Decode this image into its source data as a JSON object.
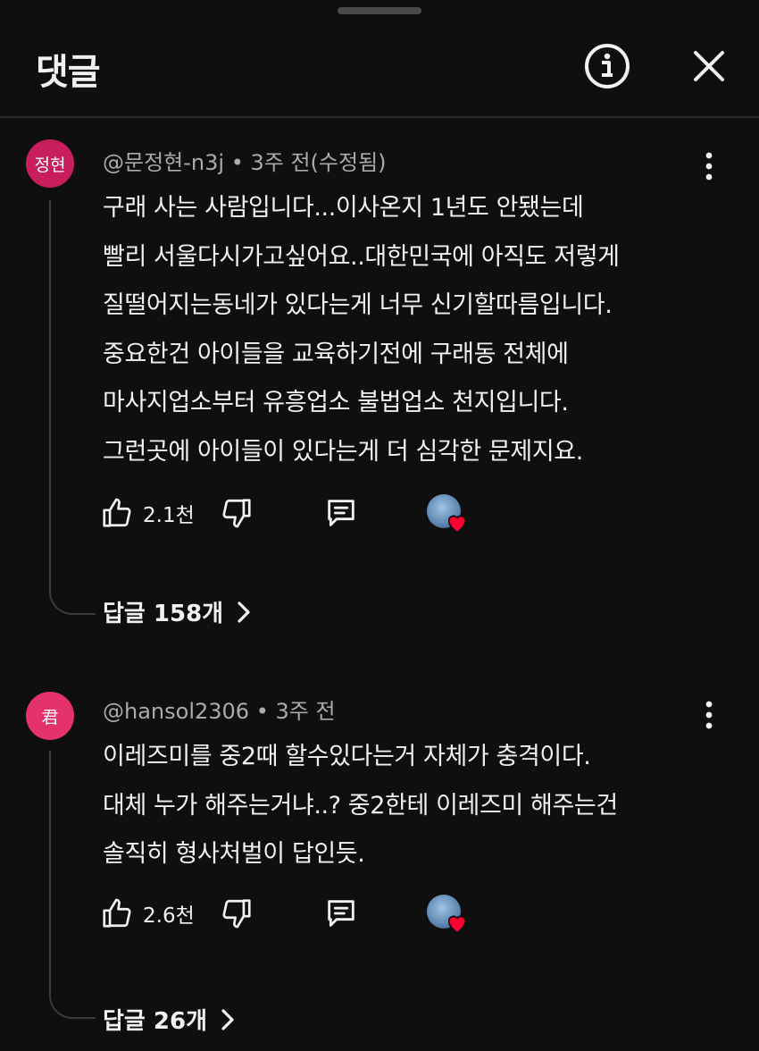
{
  "header": {
    "title": "댓글"
  },
  "icons": {
    "info": "info-icon",
    "close": "close-icon",
    "more": "more-vert-icon",
    "like": "thumbs-up-icon",
    "dislike": "thumbs-down-icon",
    "reply": "comment-reply-icon",
    "hearted": "creator-heart-icon",
    "chevron": "chevron-right-icon"
  },
  "colors": {
    "background": "#0f0f0f",
    "text": "#f1f1f1",
    "secondary_text": "#aaaaaa",
    "heart": "#ff0033"
  },
  "comments": [
    {
      "avatar_text": "정현",
      "avatar_color": "#c81e5b",
      "author": "@문정현-n3j",
      "separator": "•",
      "time": "3주 전(수정됨)",
      "lines": [
        "구래 사는 사람입니다...이사온지 1년도 안됐는데",
        "빨리 서울다시가고싶어요..대한민국에 아직도 저렇게",
        "질떨어지는동네가 있다는게 너무 신기할따름입니다.",
        "중요한건 아이들을 교육하기전에 구래동 전체에",
        "마사지업소부터 유흥업소 불법업소 천지입니다.",
        "그런곳에 아이들이 있다는게 더 심각한 문제지요."
      ],
      "likes": "2.1천",
      "creator_hearted": true,
      "replies_label": "답글 158개"
    },
    {
      "avatar_text": "君",
      "avatar_color": "#e3336a",
      "author": "@hansol2306",
      "separator": "•",
      "time": "3주 전",
      "lines": [
        "이레즈미를 중2때 할수있다는거 자체가 충격이다.",
        "대체 누가 해주는거냐..? 중2한테 이레즈미 해주는건",
        "솔직히 형사처벌이 답인듯."
      ],
      "likes": "2.6천",
      "creator_hearted": true,
      "replies_label": "답글 26개"
    }
  ]
}
